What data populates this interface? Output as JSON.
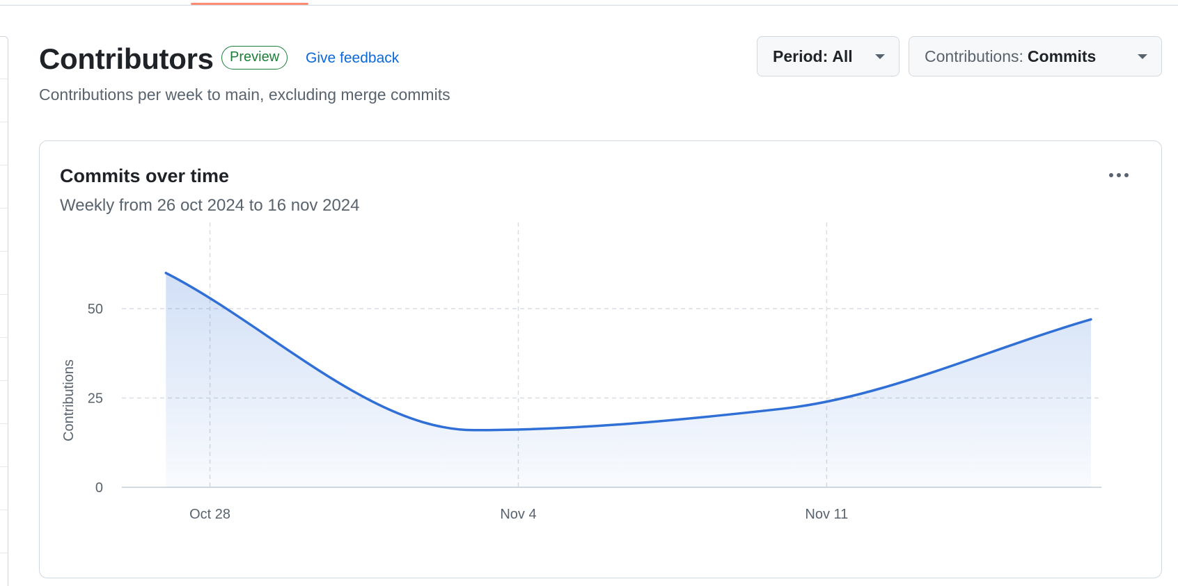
{
  "header": {
    "title": "Contributors",
    "badge": "Preview",
    "feedback_link": "Give feedback",
    "subtitle": "Contributions per week to main, excluding merge commits"
  },
  "filters": {
    "period_label": "Period:",
    "period_value": "All",
    "contributions_label": "Contributions:",
    "contributions_value": "Commits"
  },
  "card": {
    "title": "Commits over time",
    "subtitle": "Weekly from 26 oct 2024 to 16 nov 2024",
    "menu_icon": "kebab-horizontal-icon"
  },
  "colors": {
    "accent": "#0969da",
    "line": "#2f6fd6",
    "badge": "#1a7f37",
    "active_tab": "#fd8c73"
  },
  "chart_data": {
    "type": "area",
    "x": [
      "2024-10-27",
      "2024-11-03",
      "2024-11-10",
      "2024-11-17"
    ],
    "series": [
      {
        "values": [
          60,
          16,
          22,
          47
        ]
      }
    ],
    "xticks": [
      {
        "date": "2024-10-28",
        "label": "Oct 28"
      },
      {
        "date": "2024-11-04",
        "label": "Nov 4"
      },
      {
        "date": "2024-11-11",
        "label": "Nov 11"
      }
    ],
    "yticks": [
      0,
      25,
      50
    ],
    "ylabel": "Contributions",
    "ylim": [
      0,
      72
    ],
    "xlim": [
      "2024-10-26",
      "2024-11-17"
    ],
    "grid": true
  }
}
